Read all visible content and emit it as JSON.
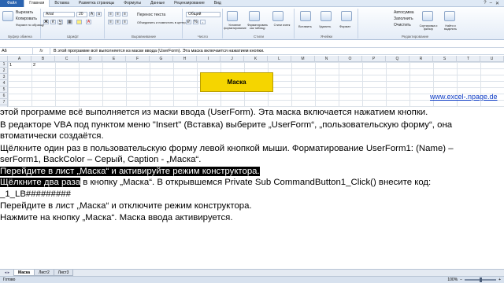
{
  "ribbon": {
    "tabs": [
      "Главная",
      "Вставка",
      "Разметка страницы",
      "Формулы",
      "Данные",
      "Рецензирование",
      "Вид"
    ],
    "clipboard": {
      "cut": "Вырезать",
      "copy": "Копировать",
      "format": "Формат по образцу",
      "label": "Буфер обмена"
    },
    "font": {
      "name": "Arial",
      "size": "20",
      "label": "Шрифт"
    },
    "alignment": {
      "wrap": "Перенос текста",
      "merge": "Объединить и поместить в центре",
      "label": "Выравнивание"
    },
    "number": {
      "format": "Общий",
      "label": "Число"
    },
    "styles": {
      "label": "Стили",
      "cond": "Условное форматирование",
      "table": "Форматировать как таблицу",
      "cell": "Стили ячеек"
    },
    "cells": {
      "insert": "Вставить",
      "delete": "Удалить",
      "format": "Формат",
      "label": "Ячейки"
    },
    "editing": {
      "autosum": "Автосумма",
      "fill": "Заполнить",
      "clear": "Очистить",
      "sort": "Сортировка и фильтр",
      "find": "Найти и выделить",
      "label": "Редактирование"
    },
    "colors": {
      "file_tab": "#2a63b0",
      "ribbon_bg": "#e4ecf7"
    }
  },
  "formula_bar": {
    "cell_ref": "A6",
    "fx": "fx",
    "content": "В этой программе всё выполняется из маски ввода (UserForm). Эта маска включается нажатием кнопки."
  },
  "grid": {
    "columns": [
      "A",
      "B",
      "C",
      "D",
      "E",
      "F",
      "G",
      "H",
      "I",
      "J",
      "K",
      "L",
      "M",
      "N",
      "O",
      "P",
      "Q",
      "R",
      "S",
      "T",
      "U"
    ],
    "rows": [
      "1",
      "2",
      "3",
      "4",
      "5",
      "6",
      "7"
    ],
    "cell_a2": "1",
    "cell_b2": "2"
  },
  "mask_button": {
    "label": "Маска",
    "color": "#f5d500"
  },
  "site_link": "www.excel-.npage.de",
  "instructions": {
    "l1": "этой программе всё выполняется из маски ввода (UserForm). Эта маска включается нажатием кнопки.",
    "l2": "В редакторе VBA под пунктом меню \"Insert\" (Вставка) выберите „UserForm“, „пользовательскую форму“, она",
    "l3": "втоматически создаётся.",
    "l4": "Щёлкните один раз в пользовательскую форму левой кнопкой мыши. Форматирование UserForm1: (Name) –",
    "l5": "serForm1, BackColor – Серый, Caption - „Маска“.",
    "l6": "Перейдите в лист „Маска“ и активируйте режим конструктора.",
    "l7a": "Щёлкните два раза",
    "l7b": " в кнопку „Маска“. В открывшемся Private Sub CommandButton1_Click()  внесите код:",
    "l8": "_1_LB#########",
    "l9": "Перейдите в лист „Маска“ и отключите режим конструктора.",
    "l10": "Нажмите на кнопку „Маска“. Маска ввода активируется."
  },
  "sheets": {
    "tabs": [
      "Маска",
      "Лист2",
      "Лист3"
    ],
    "active": "Маска"
  },
  "status": {
    "ready": "Готово",
    "zoom": "100%",
    "zoom_level": 0.5
  }
}
